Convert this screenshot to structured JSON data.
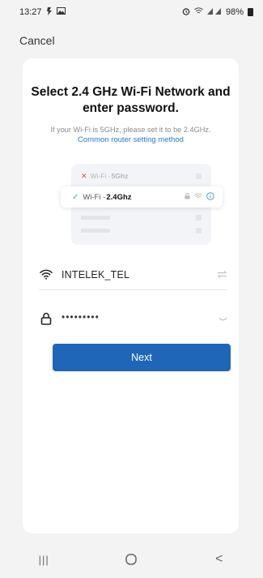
{
  "status_bar": {
    "time": "13:27",
    "battery": "98%"
  },
  "header": {
    "cancel_label": "Cancel"
  },
  "content": {
    "title": "Select 2.4 GHz Wi-Fi Network and enter password.",
    "subtitle": "If your Wi-Fi is 5GHz, please set it to be 2.4GHz.",
    "router_link": "Common router setting method"
  },
  "illustration": {
    "bad_prefix": "Wi-Fi - ",
    "bad_band": "5Ghz",
    "good_prefix": "Wi-Fi - ",
    "good_band": "2.4Ghz"
  },
  "form": {
    "ssid_value": "INTELEK_TEL",
    "password_value": "•••••••••"
  },
  "actions": {
    "next_label": "Next"
  },
  "nav": {
    "recents": "|||",
    "back": "<"
  },
  "colors": {
    "accent": "#1f66b8",
    "link": "#1e78d2",
    "ok": "#33b37e",
    "error": "#e04a4a"
  }
}
